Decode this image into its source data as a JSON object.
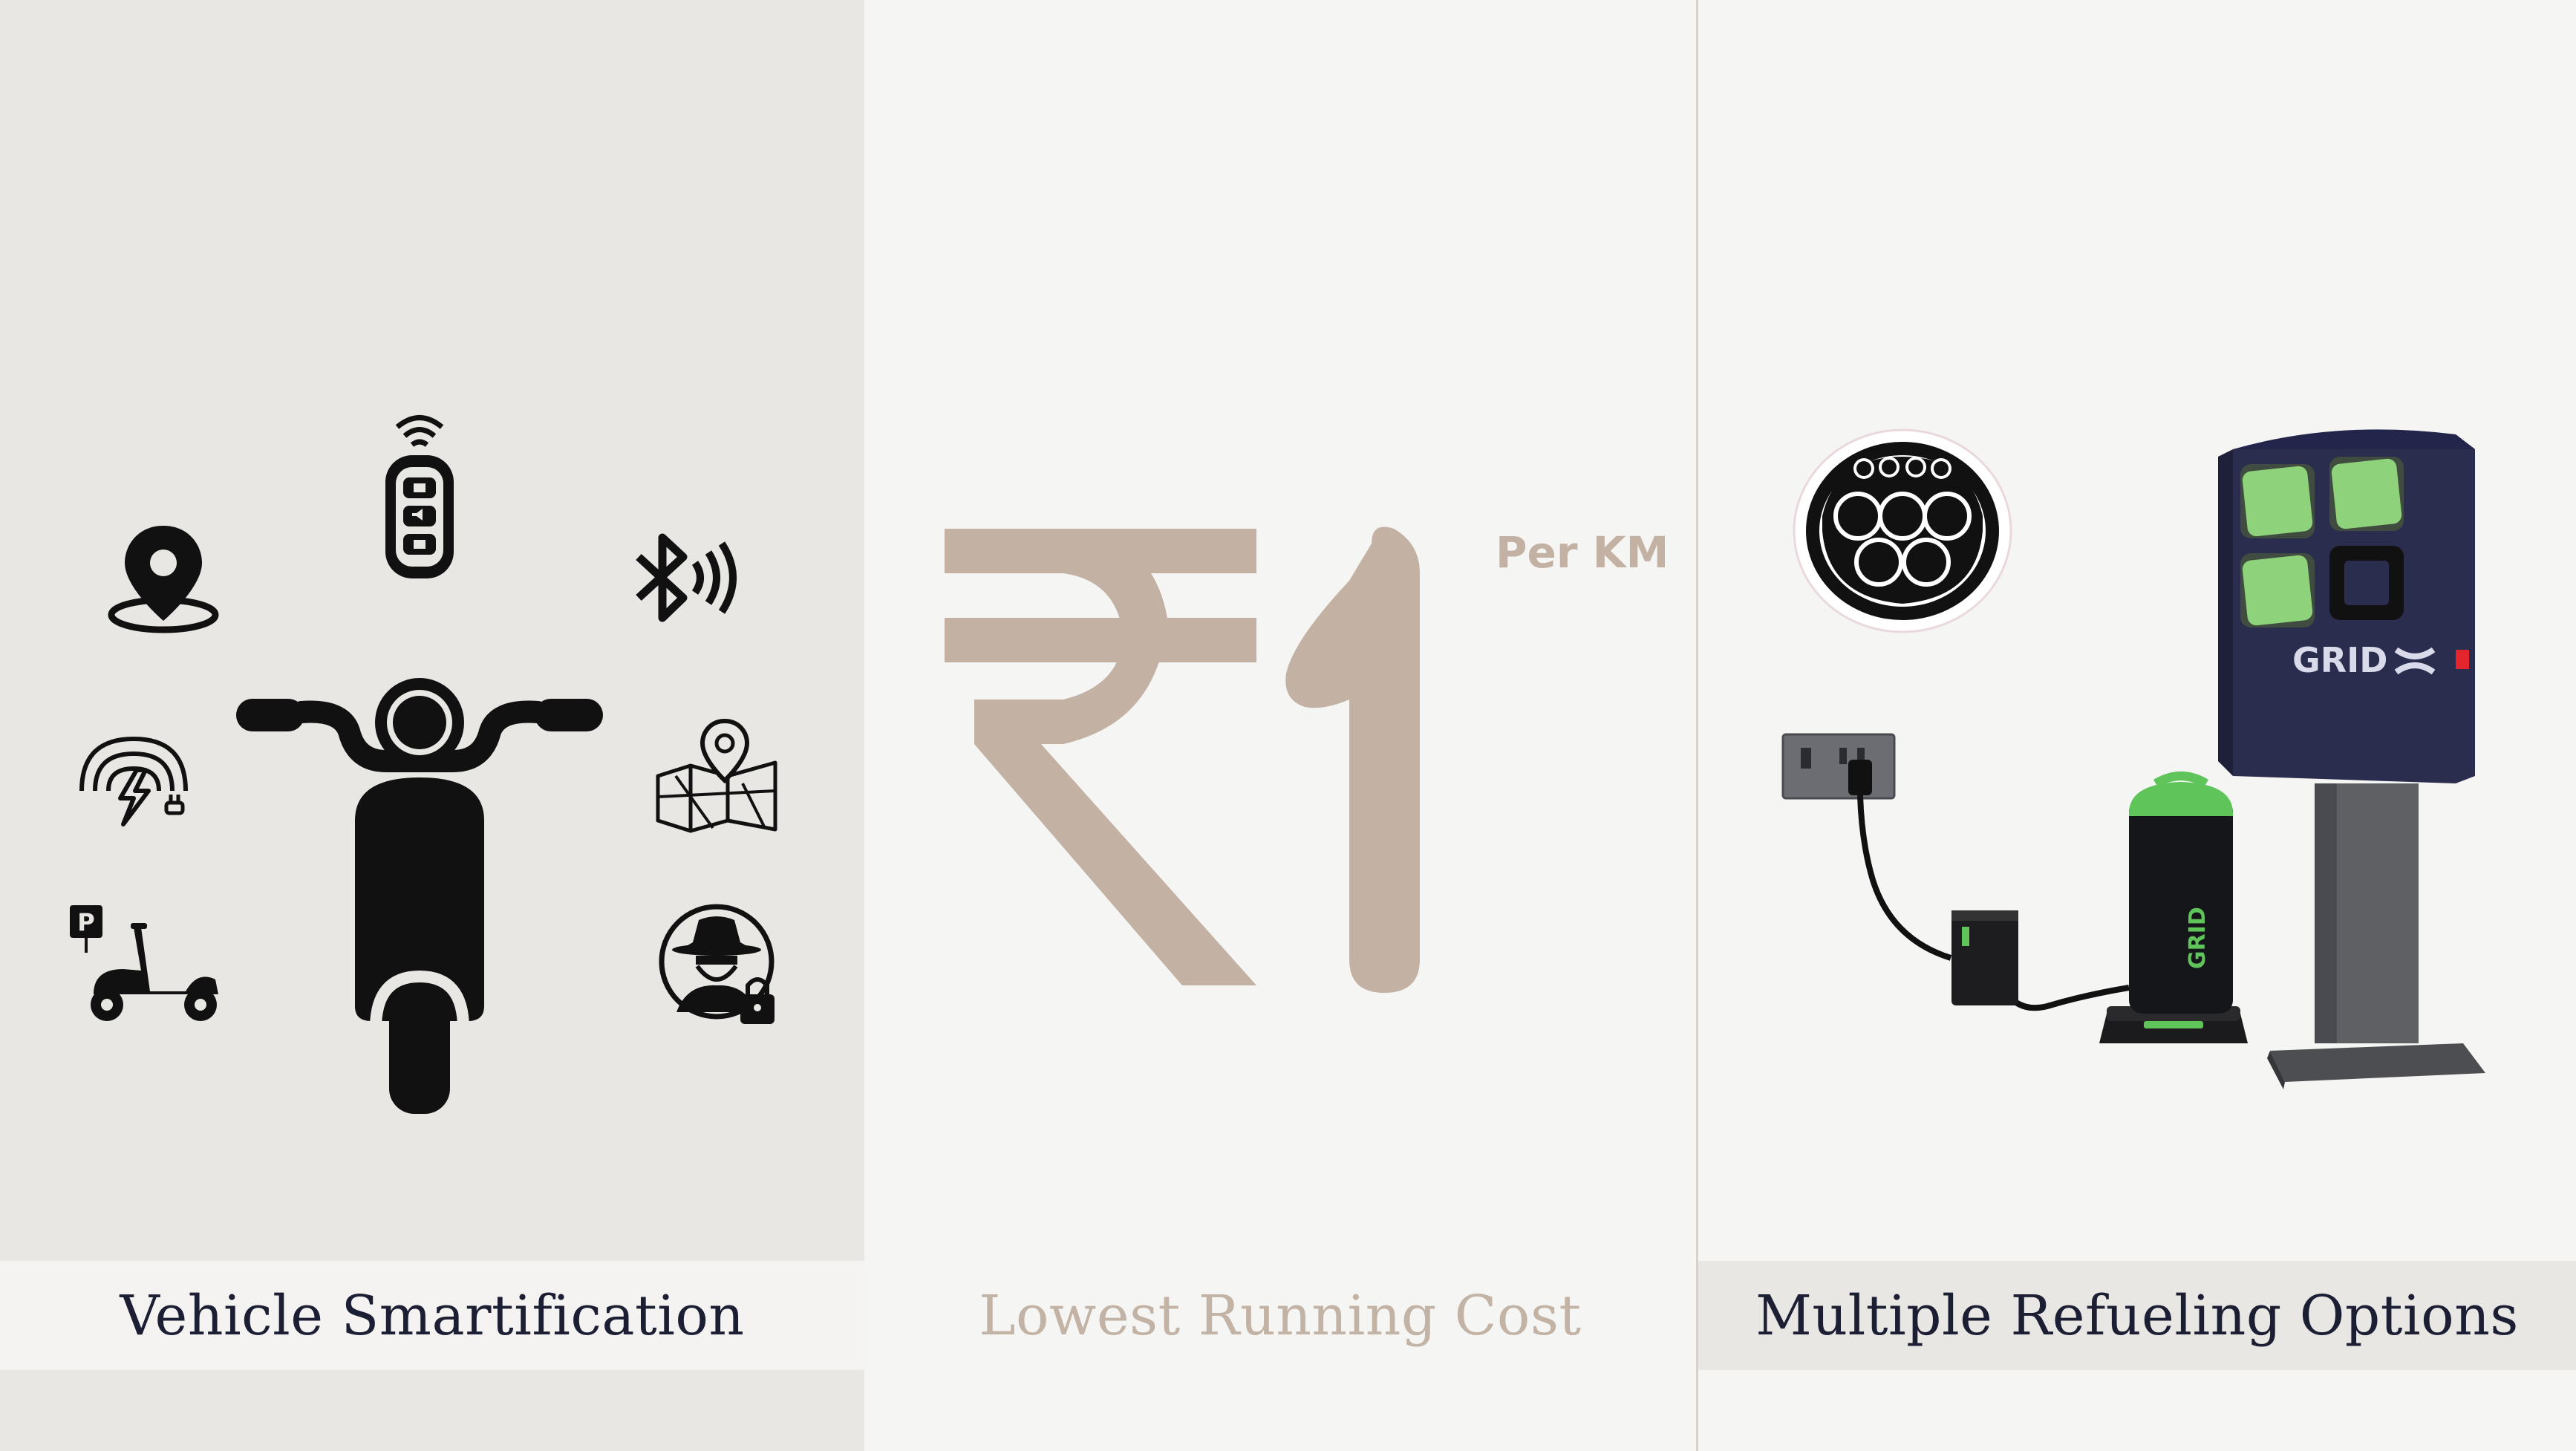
{
  "panels": {
    "left": {
      "caption": "Vehicle Smartification",
      "icons": [
        "location-pin-icon",
        "key-fob-icon",
        "bluetooth-icon",
        "wireless-charging-icon",
        "map-icon",
        "parking-scooter-icon",
        "anti-theft-icon",
        "scooter-front-icon"
      ]
    },
    "middle": {
      "price": "₹1",
      "unit": "Per KM",
      "caption": "Lowest Running Cost"
    },
    "right": {
      "caption": "Multiple Refueling Options",
      "icons": [
        "charging-connector-icon",
        "wall-socket-icon",
        "portable-charger-icon",
        "charging-station-icon"
      ],
      "brand_text": "GRID"
    }
  },
  "colors": {
    "tan": "#c3b2a3",
    "navy": "#1c1e33",
    "station_blue": "#2b2d4e",
    "led_green": "#5fc45a"
  }
}
